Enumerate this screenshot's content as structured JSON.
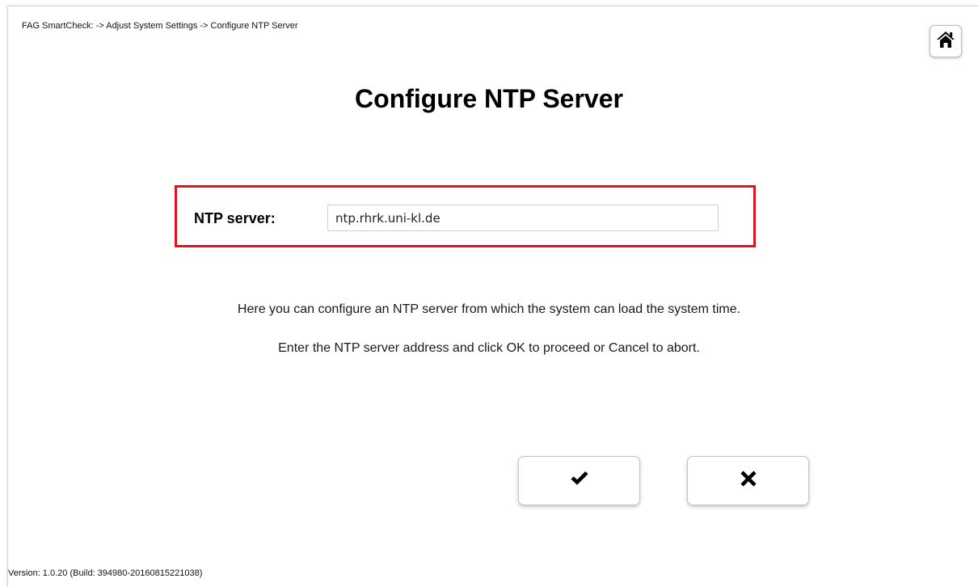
{
  "header": {
    "breadcrumb": "FAG SmartCheck: -> Adjust System Settings -> Configure NTP Server",
    "home_icon": "home-icon"
  },
  "main": {
    "title": "Configure NTP Server",
    "ntp_field": {
      "label": "NTP server:",
      "value": "ntp.rhrk.uni-kl.de"
    },
    "highlight_color": "#e3131b",
    "description_1": "Here you can configure an NTP server from which the system can load the system time.",
    "description_2": "Enter the NTP server address and click OK to proceed or Cancel to abort."
  },
  "actions": {
    "ok_icon": "checkmark-icon",
    "cancel_icon": "x-icon"
  },
  "footer": {
    "version": "Version: 1.0.20 (Build: 394980-20160815221038)"
  }
}
